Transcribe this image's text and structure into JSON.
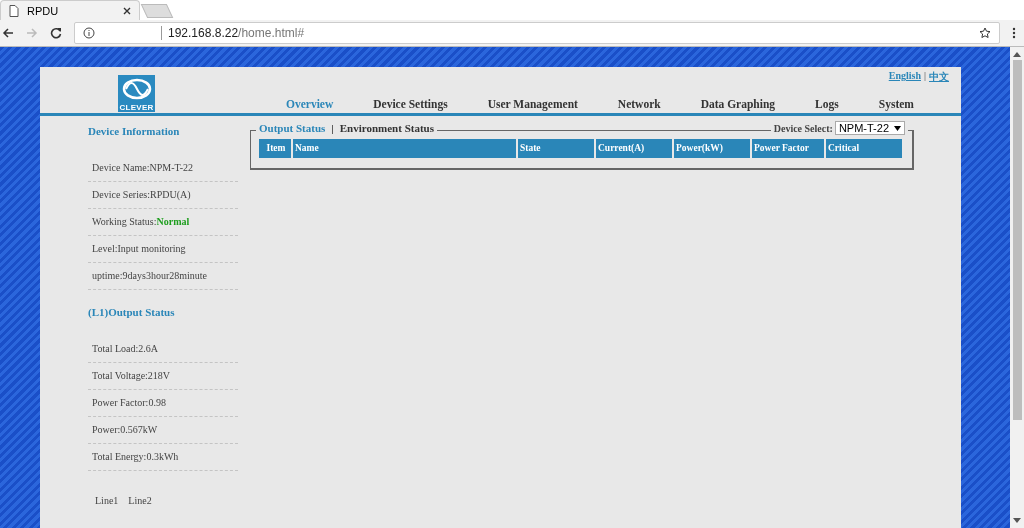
{
  "browser": {
    "tab_title": "RPDU",
    "url_host": "192.168.8.22",
    "url_path": "/home.html#"
  },
  "header": {
    "logo_text": "CLEVER",
    "languages": [
      {
        "label": "English"
      },
      {
        "label": "中文"
      }
    ],
    "separator": "|",
    "nav": [
      {
        "label": "Overview",
        "selected": true
      },
      {
        "label": "Device Settings",
        "selected": false
      },
      {
        "label": "User Management",
        "selected": false
      },
      {
        "label": "Network",
        "selected": false
      },
      {
        "label": "Data Graphing",
        "selected": false
      },
      {
        "label": "Logs",
        "selected": false
      },
      {
        "label": "System",
        "selected": false
      }
    ]
  },
  "sidebar": {
    "sections": [
      {
        "title": "Device Information",
        "items": [
          {
            "label": "Device Name:NPM-T-22"
          },
          {
            "label": "Device Series:RPDU(A)"
          },
          {
            "label": "Working Status:",
            "value": "Normal",
            "color": "#1f9e1f"
          },
          {
            "label": "Level:Input monitoring"
          },
          {
            "label": "uptime:9days3hour28minute"
          }
        ]
      },
      {
        "title": "(L1)Output Status",
        "items": [
          {
            "label": "Total Load:2.6A"
          },
          {
            "label": "Total Voltage:218V"
          },
          {
            "label": "Power Factor:0.98"
          },
          {
            "label": "Power:0.567kW"
          },
          {
            "label": "Total Energy:0.3kWh"
          }
        ]
      }
    ],
    "lines": [
      {
        "label": "Line1"
      },
      {
        "label": "Line2"
      }
    ]
  },
  "content": {
    "tabs": [
      {
        "label": "Output Status",
        "selected": true
      },
      {
        "label": "Environment Status",
        "selected": false
      }
    ],
    "tab_separator": "|",
    "device_select": {
      "label": "Device Select:",
      "value": "NPM-T-22"
    },
    "table": {
      "columns": [
        "Item",
        "Name",
        "State",
        "Current(A)",
        "Power(kW)",
        "Power Factor",
        "Critical"
      ]
    }
  }
}
